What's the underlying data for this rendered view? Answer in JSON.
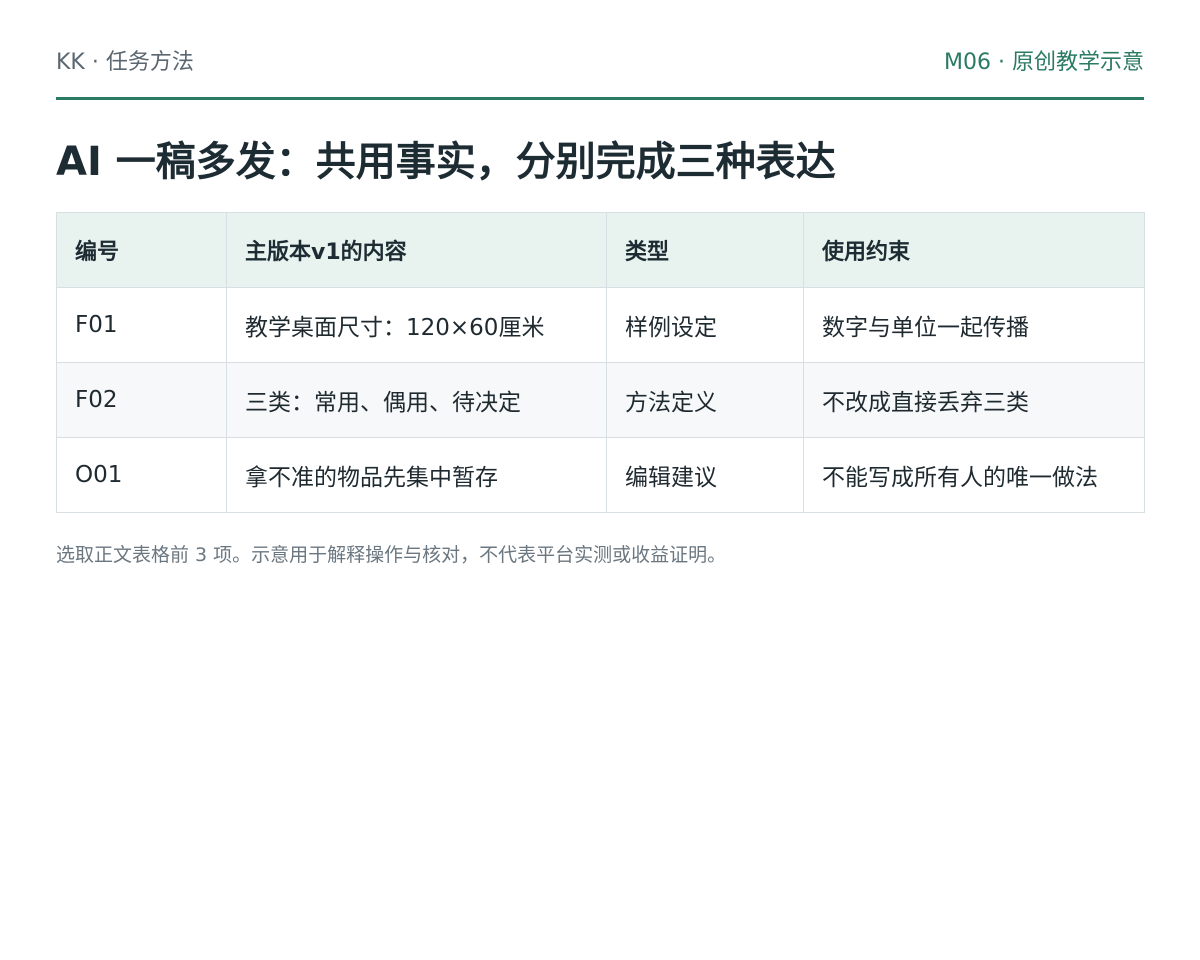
{
  "header": {
    "left": "KK · 任务方法",
    "right": "M06 · 原创教学示意"
  },
  "title": "AI 一稿多发：共用事实，分别完成三种表达",
  "table": {
    "headers": [
      "编号",
      "主版本v1的内容",
      "类型",
      "使用约束"
    ],
    "rows": [
      [
        "F01",
        "教学桌面尺寸：120×60厘米",
        "样例设定",
        "数字与单位一起传播"
      ],
      [
        "F02",
        "三类：常用、偶用、待决定",
        "方法定义",
        "不改成直接丢弃三类"
      ],
      [
        "O01",
        "拿不准的物品先集中暂存",
        "编辑建议",
        "不能写成所有人的唯一做法"
      ]
    ]
  },
  "note": "选取正文表格前 3 项。示意用于解释操作与核对，不代表平台实测或收益证明。"
}
